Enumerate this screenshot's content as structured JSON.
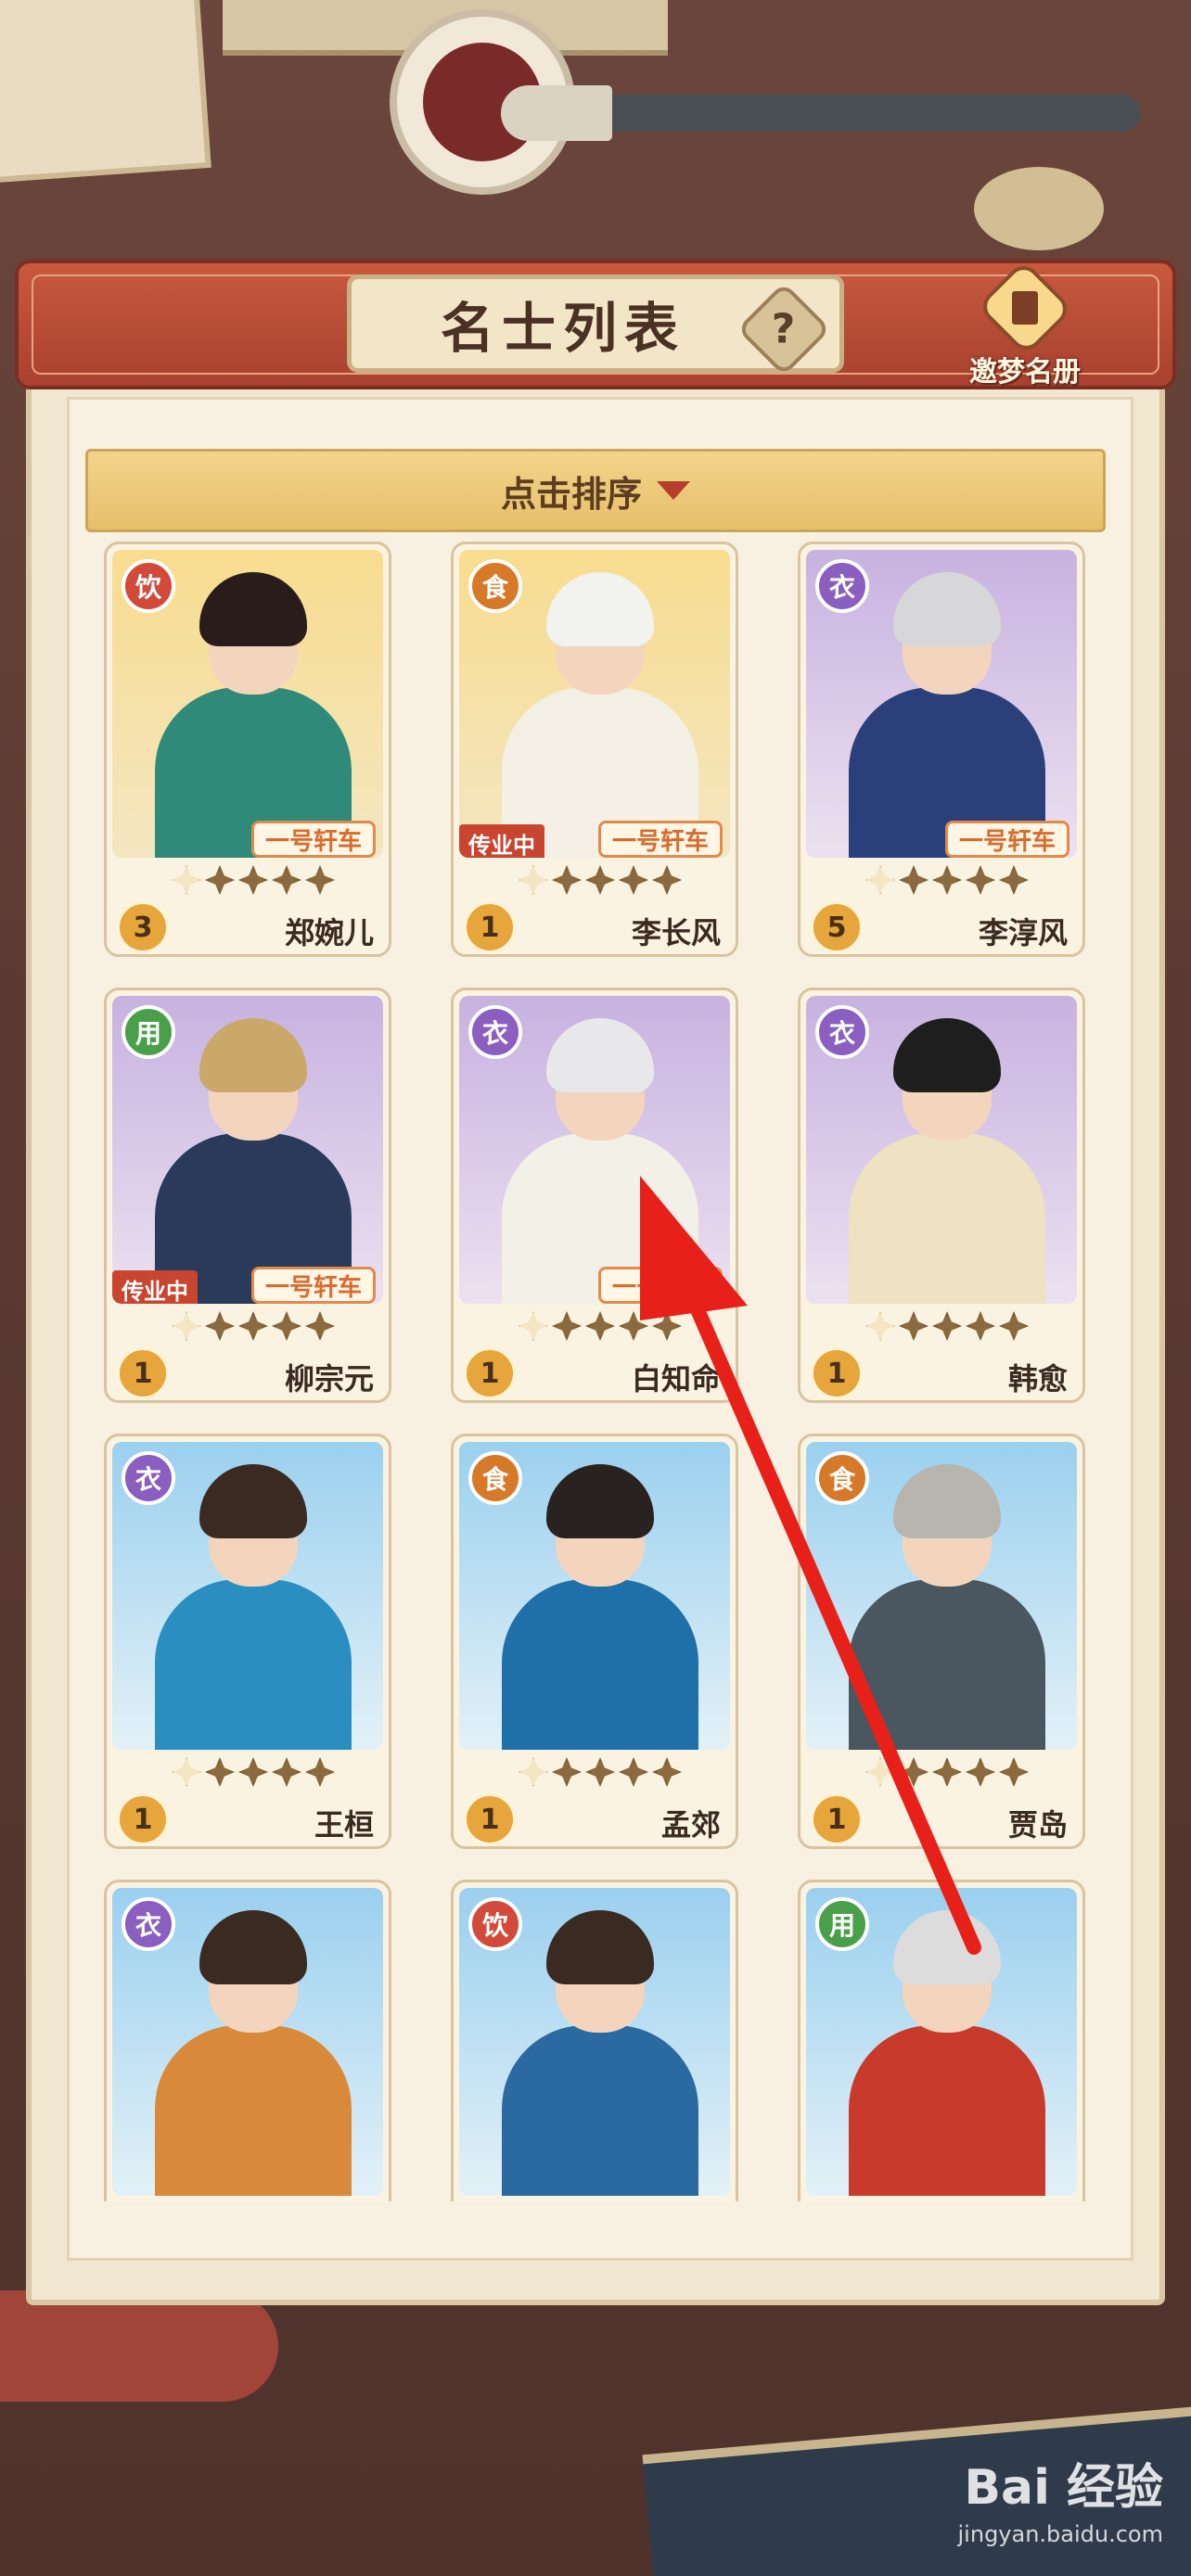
{
  "header": {
    "title": "名士列表",
    "help_label": "?",
    "book_label": "邀梦名册"
  },
  "sort": {
    "label": "点击排序"
  },
  "cards": [
    {
      "name": "郑婉儿",
      "type": "饮",
      "level": "3",
      "vehicle": "一号轩车",
      "legacy": "",
      "bg": "gold",
      "type_color": "#d24a3a",
      "hair_color": "#2a1c1a",
      "robe_color": "#2f8a7a"
    },
    {
      "name": "李长风",
      "type": "食",
      "level": "1",
      "vehicle": "一号轩车",
      "legacy": "传业中",
      "bg": "gold",
      "type_color": "#d67a2a",
      "hair_color": "#f2f2ee",
      "robe_color": "#f4f0e6"
    },
    {
      "name": "李淳风",
      "type": "衣",
      "level": "5",
      "vehicle": "一号轩车",
      "legacy": "",
      "bg": "purple",
      "type_color": "#8a5fbf",
      "hair_color": "#d7d7da",
      "robe_color": "#2b3f7a"
    },
    {
      "name": "柳宗元",
      "type": "用",
      "level": "1",
      "vehicle": "一号轩车",
      "legacy": "传业中",
      "bg": "purple",
      "type_color": "#4aa04a",
      "hair_color": "#c9a86a",
      "robe_color": "#2a3a5a"
    },
    {
      "name": "白知命",
      "type": "衣",
      "level": "1",
      "vehicle": "一号轩车",
      "legacy": "",
      "bg": "purple",
      "type_color": "#8a5fbf",
      "hair_color": "#e8e8ea",
      "robe_color": "#f3f0e8"
    },
    {
      "name": "韩愈",
      "type": "衣",
      "level": "1",
      "vehicle": "",
      "legacy": "",
      "bg": "purple",
      "type_color": "#8a5fbf",
      "hair_color": "#1e1e1e",
      "robe_color": "#efe2c2"
    },
    {
      "name": "王桓",
      "type": "衣",
      "level": "1",
      "vehicle": "",
      "legacy": "",
      "bg": "blue",
      "type_color": "#8a5fbf",
      "hair_color": "#3a2a22",
      "robe_color": "#2a8fc0"
    },
    {
      "name": "孟郊",
      "type": "食",
      "level": "1",
      "vehicle": "",
      "legacy": "",
      "bg": "blue",
      "type_color": "#d67a2a",
      "hair_color": "#2a2220",
      "robe_color": "#1f6fa8"
    },
    {
      "name": "贾岛",
      "type": "食",
      "level": "1",
      "vehicle": "",
      "legacy": "",
      "bg": "blue",
      "type_color": "#d67a2a",
      "hair_color": "#b8b4ae",
      "robe_color": "#4a5660"
    },
    {
      "name": "",
      "type": "衣",
      "level": "",
      "vehicle": "",
      "legacy": "",
      "bg": "blue",
      "type_color": "#8a5fbf",
      "hair_color": "#3a2a22",
      "robe_color": "#d88a3a"
    },
    {
      "name": "",
      "type": "饮",
      "level": "",
      "vehicle": "",
      "legacy": "",
      "bg": "blue",
      "type_color": "#d24a3a",
      "hair_color": "#3a2a22",
      "robe_color": "#2b6aa0"
    },
    {
      "name": "",
      "type": "用",
      "level": "",
      "vehicle": "",
      "legacy": "",
      "bg": "blue",
      "type_color": "#4aa04a",
      "hair_color": "#dcdcdc",
      "robe_color": "#c83a2a"
    }
  ],
  "watermark": {
    "main": "Bai 经验",
    "sub": "jingyan.baidu.com"
  },
  "colors": {
    "panel": "#f2e7d1",
    "header": "#b84a35",
    "sort_bar": "#ecca7a",
    "arrow": "#e8201a"
  }
}
